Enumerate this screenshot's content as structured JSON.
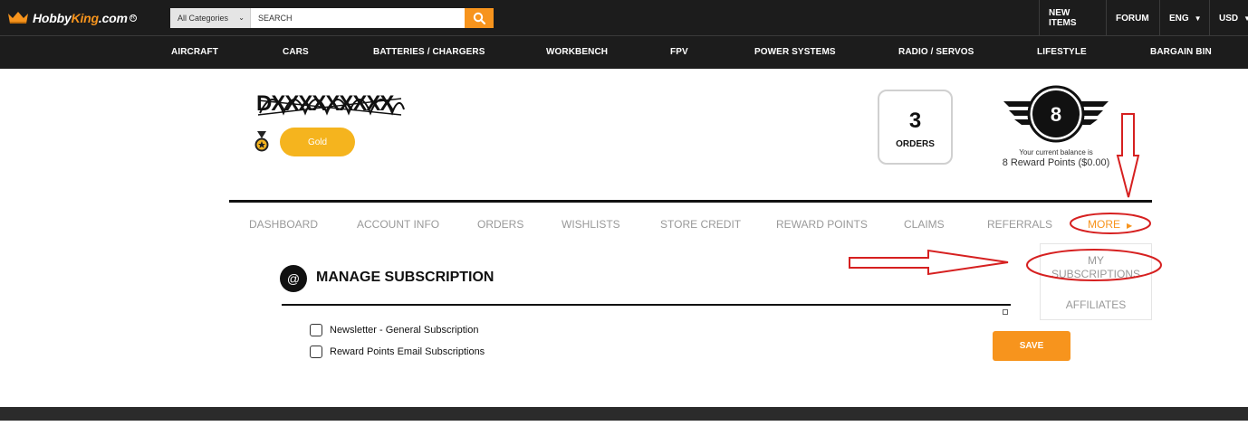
{
  "header": {
    "brand_main": "Hobby",
    "brand_accent": "King",
    "brand_suffix": ".com",
    "category_select": "All Categories",
    "search_placeholder": "SEARCH",
    "links": [
      "NEW ITEMS",
      "FORUM",
      "ENG",
      "USD"
    ]
  },
  "nav": [
    "AIRCRAFT",
    "CARS",
    "BATTERIES / CHARGERS",
    "WORKBENCH",
    "FPV",
    "POWER SYSTEMS",
    "RADIO / SERVOS",
    "LIFESTYLE",
    "BARGAIN BIN"
  ],
  "profile": {
    "username": "DXXXXXXXXX",
    "tier": "Gold",
    "orders_count": "3",
    "orders_label": "ORDERS",
    "points_badge": "8",
    "balance_caption": "Your current balance is",
    "balance_value": "8 Reward Points ($0.00)"
  },
  "tabs": [
    "DASHBOARD",
    "ACCOUNT INFO",
    "ORDERS",
    "WISHLISTS",
    "STORE CREDIT",
    "REWARD POINTS",
    "CLAIMS",
    "REFERRALS"
  ],
  "more_label": "MORE",
  "more_menu": {
    "my_subs_line1": "MY",
    "my_subs_line2": "SUBSCRIPTIONS",
    "affiliates": "AFFILIATES"
  },
  "subscription": {
    "icon_text": "@",
    "title": "MANAGE SUBSCRIPTION",
    "options": [
      "Newsletter - General Subscription",
      "Reward Points Email Subscriptions"
    ],
    "options_checked": [
      false,
      false
    ],
    "save_label": "SAVE"
  },
  "colors": {
    "accent": "#f7941d",
    "gold": "#f5b41e",
    "header_bg": "#1c1c1c",
    "annotation": "#d62020"
  },
  "icons": [
    "crown-icon",
    "chevron-down-icon",
    "search-icon",
    "caret-down-icon",
    "medal-icon",
    "winged-badge-icon",
    "caret-right-icon",
    "at-icon"
  ]
}
